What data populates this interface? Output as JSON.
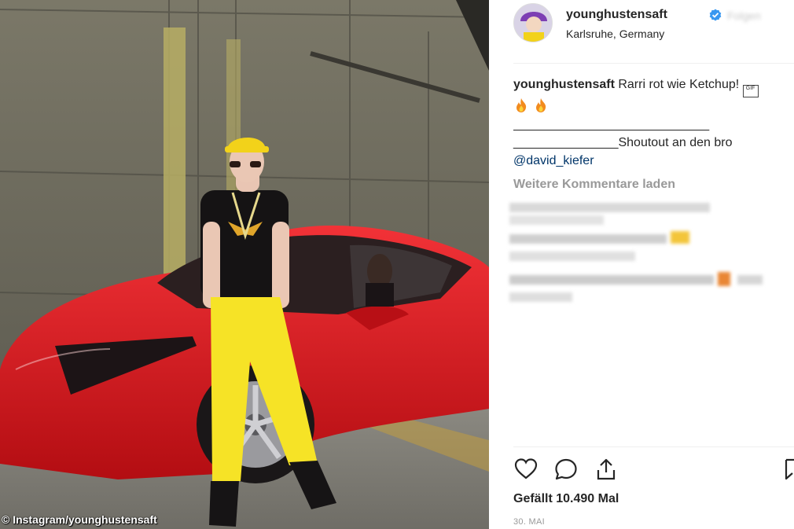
{
  "post": {
    "username": "younghustensaft",
    "location": "Karlsruhe, Germany",
    "follow_label": "Folgen",
    "caption_user": "younghustensaft",
    "caption_text": "Rarri rot wie Ketchup!",
    "gif_glyph": "GIF",
    "caption_rule_1": "____________________________",
    "caption_rule_2": "_______________",
    "caption_shoutout": "Shoutout an den bro",
    "caption_mention": "@david_kiefer",
    "load_more_comments": "Weitere Kommentare laden",
    "likes": "Gefällt 10.490 Mal",
    "date": "30. MAI"
  },
  "photo": {
    "credit": "© Instagram/younghustensaft"
  },
  "icons": {
    "verified": "verified-badge-icon",
    "fire": "fire-emoji-icon",
    "like": "heart-icon",
    "comment": "comment-bubble-icon",
    "share": "share-upload-icon",
    "save": "bookmark-icon"
  },
  "colors": {
    "verified_blue": "#3897f0",
    "car_red": "#d8141a",
    "text": "#262626",
    "muted": "#999999"
  }
}
